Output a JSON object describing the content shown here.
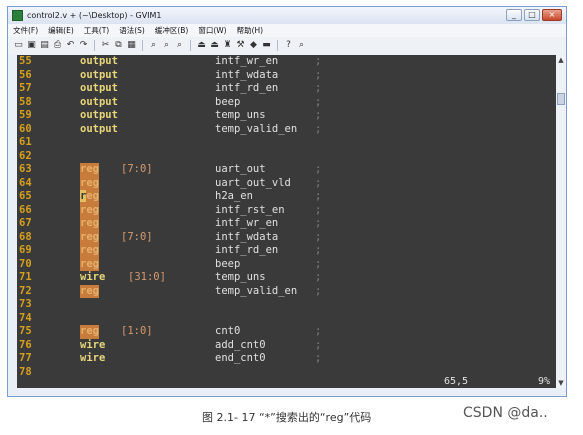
{
  "window": {
    "title": "control2.v + (~\\Desktop) - GVIM1",
    "buttons": [
      "_",
      "□",
      "×"
    ]
  },
  "menu": [
    "文件(F)",
    "编辑(E)",
    "工具(T)",
    "语法(S)",
    "缓冲区(B)",
    "窗口(W)",
    "帮助(H)"
  ],
  "toolbar_icons": [
    "open-icon",
    "save-icon",
    "save-all-icon",
    "print-icon",
    "undo-icon",
    "redo-icon",
    "cut-icon",
    "copy-icon",
    "paste-icon",
    "find-icon",
    "find-next-icon",
    "find-prev-icon",
    "load-session-icon",
    "save-session-icon",
    "run-script-icon",
    "make-icon",
    "shell-icon",
    "tags-icon",
    "help-icon",
    "find-help-icon"
  ],
  "toolbar_glyphs": [
    "▭",
    "▣",
    "▤",
    "⎙",
    "↶",
    "↷",
    "✂",
    "⧉",
    "▦",
    "⌕",
    "⌕",
    "⌕",
    "⏏",
    "⏏",
    "♜",
    "⚒",
    "◆",
    "▬",
    "?",
    "⌕"
  ],
  "lines": [
    {
      "n": "55",
      "kw": "output",
      "rng": "",
      "sig": "intf_wr_en",
      "semi": ";",
      "hl": false
    },
    {
      "n": "56",
      "kw": "output",
      "rng": "",
      "sig": "intf_wdata",
      "semi": ";",
      "hl": false
    },
    {
      "n": "57",
      "kw": "output",
      "rng": "",
      "sig": "intf_rd_en",
      "semi": ";",
      "hl": false
    },
    {
      "n": "58",
      "kw": "output",
      "rng": "",
      "sig": "beep",
      "semi": ";",
      "hl": false
    },
    {
      "n": "59",
      "kw": "output",
      "rng": "",
      "sig": "temp_uns",
      "semi": ";",
      "hl": false
    },
    {
      "n": "60",
      "kw": "output",
      "rng": "",
      "sig": "temp_valid_en",
      "semi": ";",
      "hl": false
    },
    {
      "n": "61",
      "kw": "",
      "rng": "",
      "sig": "",
      "semi": "",
      "hl": false
    },
    {
      "n": "62",
      "kw": "",
      "rng": "",
      "sig": "",
      "semi": "",
      "hl": false
    },
    {
      "n": "63",
      "kw": "reg",
      "rng": "[7:0]",
      "sig": "uart_out",
      "semi": ";",
      "hl": true
    },
    {
      "n": "64",
      "kw": "reg",
      "rng": "",
      "sig": "uart_out_vld",
      "semi": ";",
      "hl": true
    },
    {
      "n": "65",
      "kw": "reg",
      "rng": "",
      "sig": "h2a_en",
      "semi": ";",
      "hl": true,
      "cursor": true
    },
    {
      "n": "66",
      "kw": "reg",
      "rng": "",
      "sig": "intf_rst_en",
      "semi": ";",
      "hl": true
    },
    {
      "n": "67",
      "kw": "reg",
      "rng": "",
      "sig": "intf_wr_en",
      "semi": ";",
      "hl": true
    },
    {
      "n": "68",
      "kw": "reg",
      "rng": "[7:0]",
      "sig": "intf_wdata",
      "semi": ";",
      "hl": true
    },
    {
      "n": "69",
      "kw": "reg",
      "rng": "",
      "sig": "intf_rd_en",
      "semi": ";",
      "hl": true
    },
    {
      "n": "70",
      "kw": "reg",
      "rng": "",
      "sig": "beep",
      "semi": ";",
      "hl": true
    },
    {
      "n": "71",
      "kw": "wire",
      "rng": "[31:0]",
      "sig": "temp_uns",
      "semi": ";",
      "hl": false
    },
    {
      "n": "72",
      "kw": "reg",
      "rng": "",
      "sig": "temp_valid_en",
      "semi": ";",
      "hl": true
    },
    {
      "n": "73",
      "kw": "",
      "rng": "",
      "sig": "",
      "semi": "",
      "hl": false
    },
    {
      "n": "74",
      "kw": "",
      "rng": "",
      "sig": "",
      "semi": "",
      "hl": false
    },
    {
      "n": "75",
      "kw": "reg",
      "rng": "[1:0]",
      "sig": "cnt0",
      "semi": ";",
      "hl": true
    },
    {
      "n": "76",
      "kw": "wire",
      "rng": "",
      "sig": "add_cnt0",
      "semi": ";",
      "hl": false
    },
    {
      "n": "77",
      "kw": "wire",
      "rng": "",
      "sig": "end_cnt0",
      "semi": ";",
      "hl": false
    },
    {
      "n": "78",
      "kw": "",
      "rng": "",
      "sig": "",
      "semi": "",
      "hl": false
    }
  ],
  "status": {
    "position": "65,5",
    "percent": "9%"
  },
  "scrollbar": {
    "up": "▲",
    "down": "▼"
  },
  "caption": "图 2.1- 17 “*”搜索出的“reg”代码",
  "watermark": "CSDN @da.."
}
